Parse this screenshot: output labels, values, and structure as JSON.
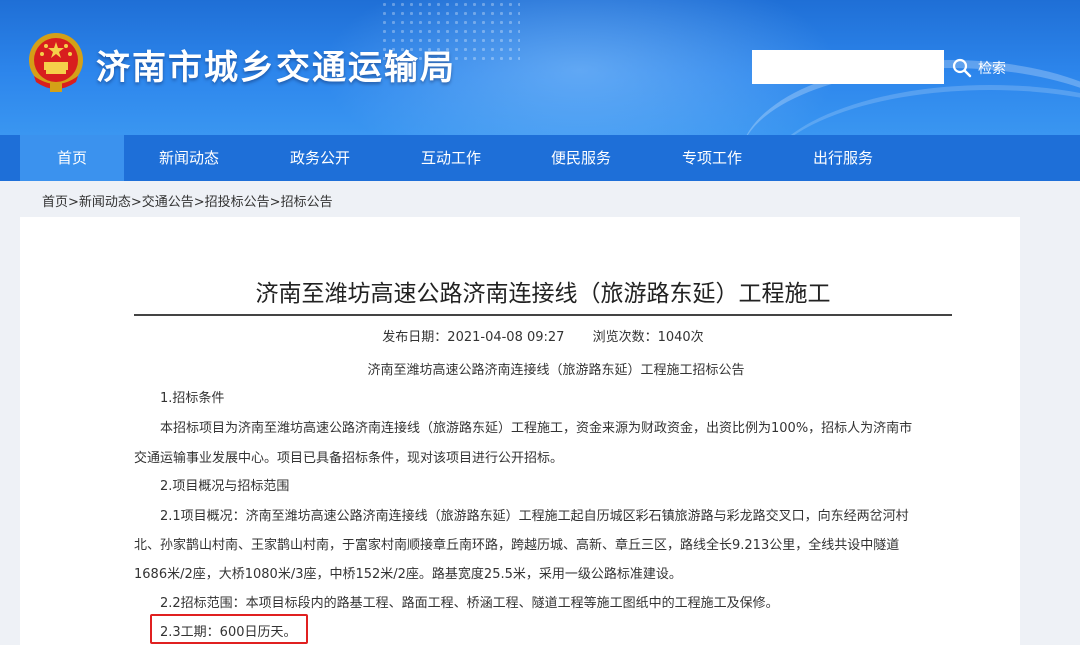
{
  "header": {
    "site_title": "济南市城乡交通运输局",
    "search": {
      "placeholder": "",
      "button_label": "检索"
    }
  },
  "nav": {
    "items": [
      {
        "label": "首页",
        "active": true
      },
      {
        "label": "新闻动态"
      },
      {
        "label": "政务公开"
      },
      {
        "label": "互动工作"
      },
      {
        "label": "便民服务"
      },
      {
        "label": "专项工作"
      },
      {
        "label": "出行服务"
      }
    ]
  },
  "breadcrumb": "首页>新闻动态>交通公告>招投标公告>招标公告",
  "article": {
    "title": "济南至潍坊高速公路济南连接线（旅游路东延）工程施工",
    "publish_date": "发布日期：2021-04-08 09:27",
    "views": "浏览次数：1040次",
    "sub_title": "济南至潍坊高速公路济南连接线（旅游路东延）工程施工招标公告",
    "paragraphs": [
      "1.招标条件",
      "本招标项目为济南至潍坊高速公路济南连接线（旅游路东延）工程施工，资金来源为财政资金，出资比例为100%，招标人为济南市",
      "交通运输事业发展中心。项目已具备招标条件，现对该项目进行公开招标。",
      "2.项目概况与招标范围",
      "2.1项目概况：济南至潍坊高速公路济南连接线（旅游路东延）工程施工起自历城区彩石镇旅游路与彩龙路交叉口，向东经两岔河村",
      "北、孙家鹊山村南、王家鹊山村南，于富家村南顺接章丘南环路，跨越历城、高新、章丘三区，路线全长9.213公里，全线共设中隧道",
      "1686米/2座，大桥1080米/3座，中桥152米/2座。路基宽度25.5米，采用一级公路标准建设。",
      "2.2招标范围：本项目标段内的路基工程、路面工程、桥涵工程、隧道工程等施工图纸中的工程施工及保修。",
      "2.3工期：600日历天。"
    ]
  },
  "colors": {
    "header_blue": "#2d86ec",
    "nav_blue": "#1e6fd8",
    "nav_active": "#3b92ee",
    "highlight_red": "#e02020"
  }
}
